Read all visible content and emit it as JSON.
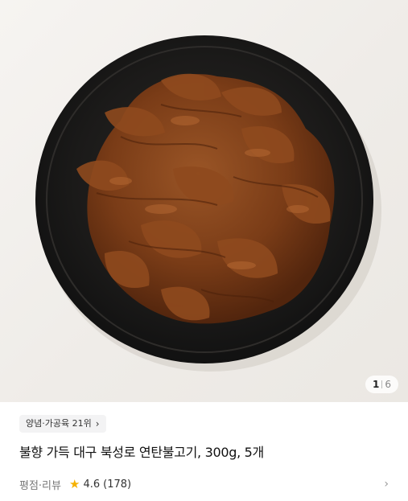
{
  "product": {
    "image_alt": "연탄불고기 plate",
    "image_index": "1",
    "image_total": "6",
    "rank_badge": "양념·가공육 21위",
    "title": "불향 가득 대구 북성로 연탄불고기, 300g, 5개",
    "rating_label": "평점·리뷰",
    "rating_value": "4.6",
    "review_count": "(178)"
  },
  "colors": {
    "star": "#f5b100",
    "plate": "#1c1b1a",
    "meat": "#7a3c17"
  },
  "icons": {
    "rank_chevron": "chevron-right-icon",
    "star": "star-icon",
    "rating_arrow": "chevron-right-icon"
  }
}
